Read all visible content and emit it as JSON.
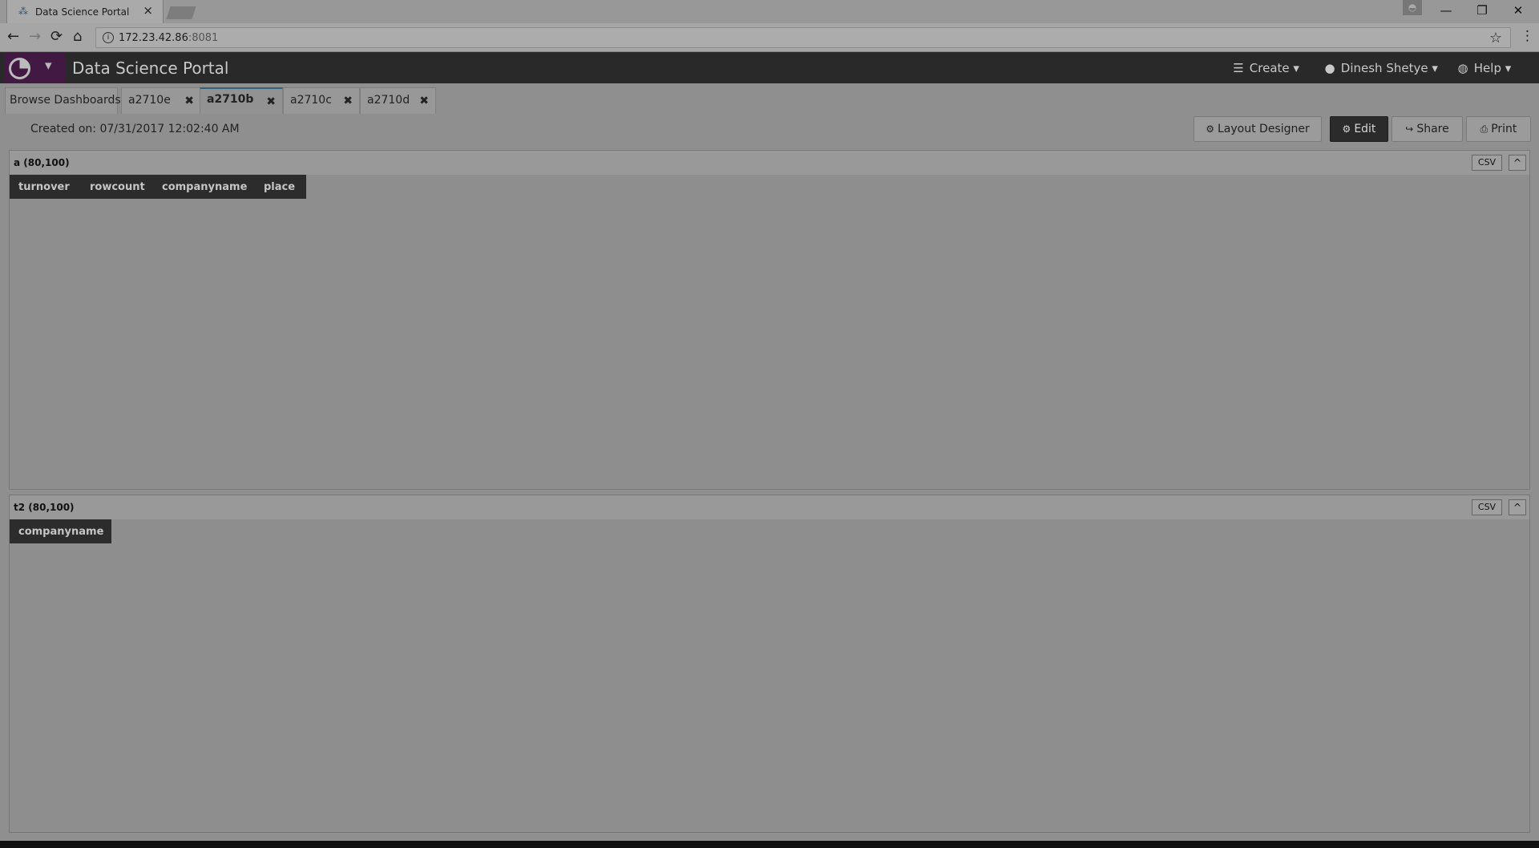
{
  "browser": {
    "tab_title": "Data Science Portal",
    "url_host": "172.23.42.86",
    "url_port": ":8081"
  },
  "app": {
    "title": "Data Science Portal",
    "menus": {
      "create": "Create",
      "user": "Dinesh Shetye",
      "help": "Help"
    }
  },
  "dashboard_tabs": {
    "browse": "Browse Dashboards",
    "tabs": [
      "a2710e",
      "a2710b",
      "a2710c",
      "a2710d"
    ],
    "active_index": 1
  },
  "created_text": "Created on: 07/31/2017 12:02:40 AM",
  "actions": {
    "layout": "Layout Designer",
    "edit": "Edit",
    "share": "Share",
    "print": "Print"
  },
  "panels": [
    {
      "title": "a (80,100)",
      "csv": "CSV",
      "collapse": "^",
      "columns": [
        "turnover",
        "rowcount",
        "companyname",
        "place"
      ]
    },
    {
      "title": "t2 (80,100)",
      "csv": "CSV",
      "collapse": "^",
      "columns": [
        "companyname"
      ]
    }
  ],
  "icons": {
    "info": "i",
    "star": "☆",
    "menu": "⋮",
    "back": "←",
    "forward": "→",
    "reload": "⟳",
    "home": "⌂"
  }
}
